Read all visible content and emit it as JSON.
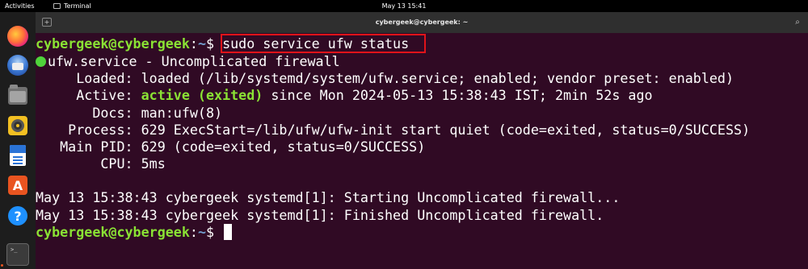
{
  "topbar": {
    "activities": "Activities",
    "app_name": "Terminal",
    "clock": "May 13  15:41"
  },
  "dock": {
    "items": [
      "firefox-icon",
      "thunderbird-icon",
      "files-icon",
      "rhythmbox-icon",
      "writer-icon",
      "app-center-icon",
      "help-icon",
      "terminal-icon"
    ],
    "appcenter_glyph": "A",
    "help_glyph": "?",
    "terminal_glyph": ">_"
  },
  "window": {
    "title": "cybergeek@cybergeek: ~"
  },
  "terminal": {
    "prompt_user": "cybergeek@cybergeek",
    "prompt_sep": ":",
    "prompt_path": "~",
    "prompt_symbol": "$ ",
    "command": "sudo service ufw status",
    "service_line": "ufw.service - Uncomplicated firewall",
    "loaded_line": "     Loaded: loaded (/lib/systemd/system/ufw.service; enabled; vendor preset: enabled)",
    "active_label": "     Active: ",
    "active_status": "active (exited)",
    "active_rest": " since Mon 2024-05-13 15:38:43 IST; 2min 52s ago",
    "docs_line": "       Docs: man:ufw(8)",
    "process_line": "    Process: 629 ExecStart=/lib/ufw/ufw-init start quiet (code=exited, status=0/SUCCESS)",
    "mainpid_line": "   Main PID: 629 (code=exited, status=0/SUCCESS)",
    "cpu_line": "        CPU: 5ms",
    "log_lines": [
      "May 13 15:38:43 cybergeek systemd[1]: Starting Uncomplicated firewall...",
      "May 13 15:38:43 cybergeek systemd[1]: Finished Uncomplicated firewall."
    ]
  },
  "colors": {
    "terminal_bg": "#300a24",
    "prompt_user": "#8ae234",
    "prompt_path": "#729fcf",
    "highlight_box": "#e0131a",
    "status_dot": "#4fd33b"
  }
}
